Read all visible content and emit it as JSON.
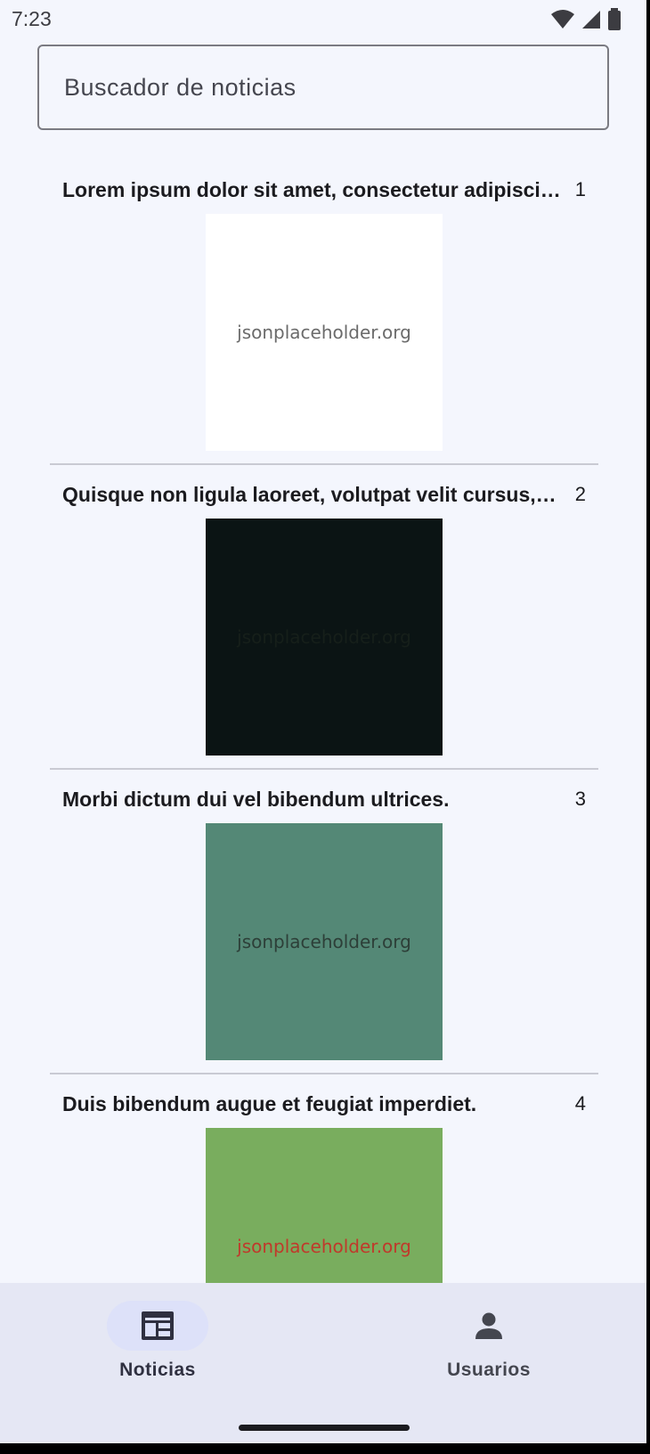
{
  "status_bar": {
    "time": "7:23",
    "icons": [
      "wifi-icon",
      "signal-icon",
      "battery-icon"
    ]
  },
  "search": {
    "placeholder": "Buscador de noticias"
  },
  "news": [
    {
      "title": "Lorem ipsum dolor sit amet, consectetur adipiscing elit.",
      "number": "1",
      "image_text": "jsonplaceholder.org",
      "image_bg": "#ffffff",
      "image_text_color": "#6b6b6b"
    },
    {
      "title": "Quisque non ligula laoreet, volutpat velit cursus, condimentum.",
      "number": "2",
      "image_text": "jsonplaceholder.org",
      "image_bg": "#0b1414",
      "image_text_color": "#161f1a"
    },
    {
      "title": "Morbi dictum dui vel bibendum ultrices.",
      "number": "3",
      "image_text": "jsonplaceholder.org",
      "image_bg": "#548876",
      "image_text_color": "#2d3f38"
    },
    {
      "title": "Duis bibendum augue et feugiat imperdiet.",
      "number": "4",
      "image_text": "jsonplaceholder.org",
      "image_bg": "#79ad5e",
      "image_text_color": "#c0392b"
    }
  ],
  "bottom_nav": {
    "items": [
      {
        "label": "Noticias",
        "icon": "newspaper-icon",
        "selected": true
      },
      {
        "label": "Usuarios",
        "icon": "person-icon",
        "selected": false
      }
    ]
  },
  "colors": {
    "background": "#f4f6fd",
    "nav_background": "#e5e7f4",
    "nav_selected_pill": "#dde1f9",
    "divider": "#c9cad3"
  }
}
